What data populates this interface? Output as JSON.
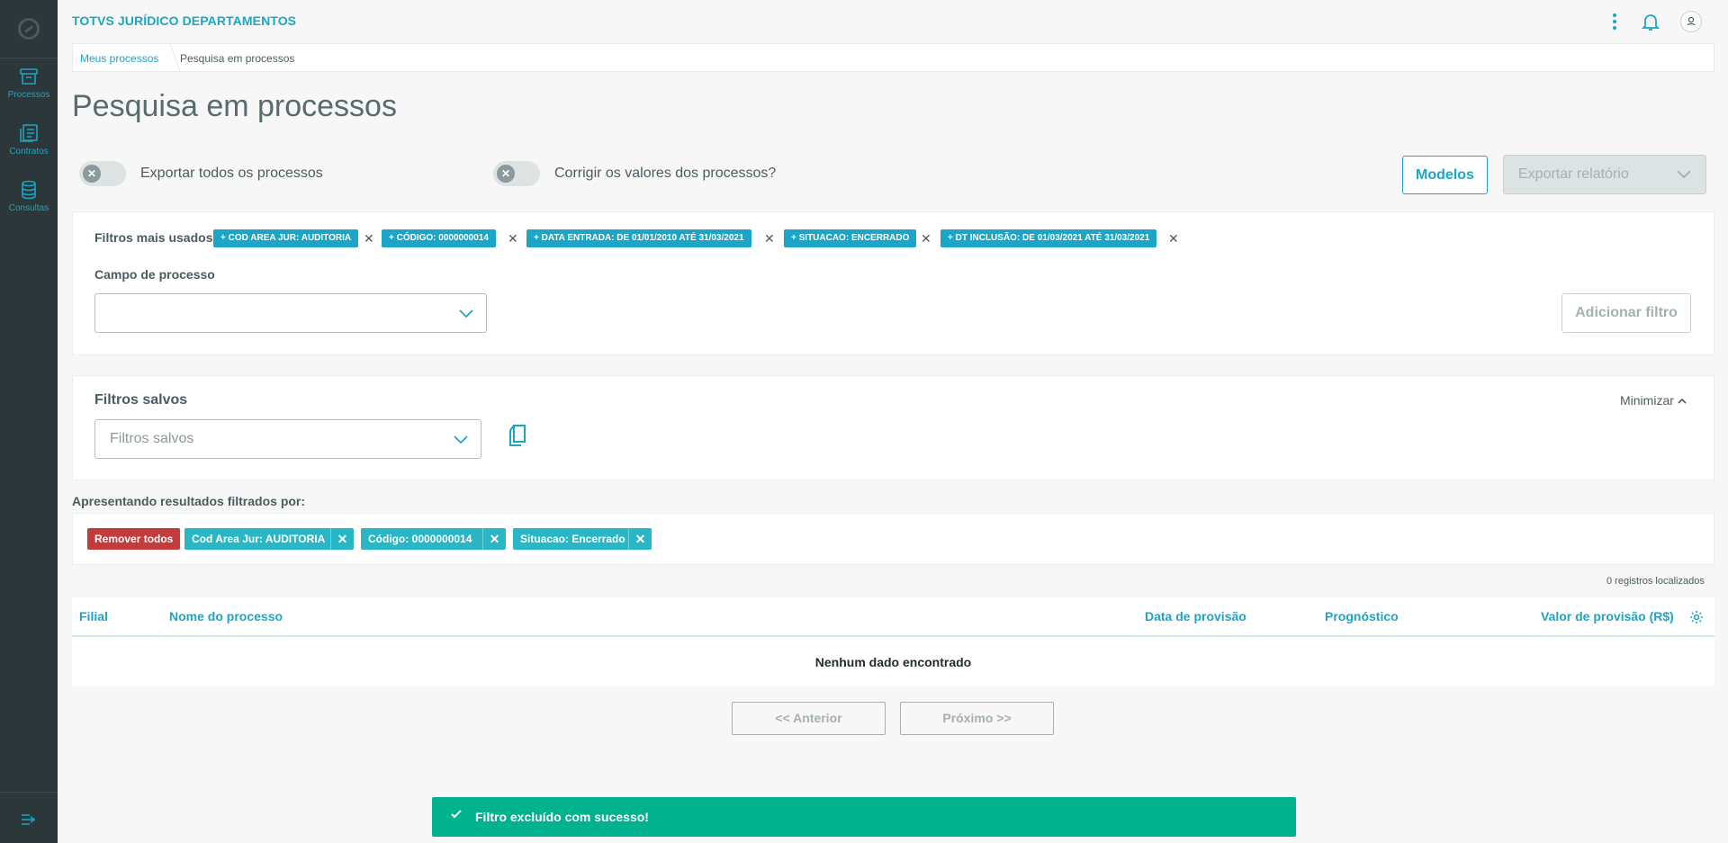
{
  "app": {
    "title": "TOTVS JURÍDICO DEPARTAMENTOS"
  },
  "sidebar": {
    "items": [
      {
        "label": "Processos",
        "icon": "archive-icon"
      },
      {
        "label": "Contratos",
        "icon": "contracts-icon"
      },
      {
        "label": "Consultas",
        "icon": "database-icon"
      }
    ]
  },
  "breadcrumb": {
    "link": "Meus processos",
    "current": "Pesquisa em processos"
  },
  "page": {
    "title": "Pesquisa em processos"
  },
  "toggles": {
    "export_all": {
      "label": "Exportar todos os processos",
      "state": "off"
    },
    "correct_values": {
      "label": "Corrigir os valores dos processos?",
      "state": "off"
    }
  },
  "actions": {
    "modelos": "Modelos",
    "export_report": "Exportar relatório"
  },
  "filters": {
    "most_used_label": "Filtros mais usados",
    "most_used": [
      "+ COD AREA JUR: AUDITORIA",
      "+ CÓDIGO: 0000000014",
      "+ DATA ENTRADA: DE 01/01/2010 ATÉ 31/03/2021",
      "+ SITUACAO: ENCERRADO",
      "+ DT INCLUSÃO: DE 01/03/2021 ATÉ 31/03/2021"
    ],
    "field_label": "Campo de processo",
    "field_value": "",
    "add_button": "Adicionar filtro"
  },
  "saved_filters": {
    "title": "Filtros salvos",
    "placeholder": "Filtros salvos",
    "minimize": "Minimizar"
  },
  "results": {
    "label": "Apresentando resultados filtrados por:",
    "remove_all": "Remover todos",
    "active": [
      "Cod Area Jur: AUDITORIA",
      "Código: 0000000014",
      "Situacao: Encerrado"
    ],
    "count": "0 registros localizados"
  },
  "table": {
    "columns": [
      "Filial",
      "Nome do processo",
      "Data de provisão",
      "Prognóstico",
      "Valor de provisão (R$)"
    ],
    "empty": "Nenhum dado encontrado"
  },
  "pagination": {
    "prev": "<< Anterior",
    "next": "Próximo >>"
  },
  "toast": {
    "message": "Filtro excluído com sucesso!"
  },
  "colors": {
    "accent": "#1ca5c6",
    "sidebar": "#2c3739",
    "danger": "#c43b3b",
    "success": "#00b28e"
  }
}
